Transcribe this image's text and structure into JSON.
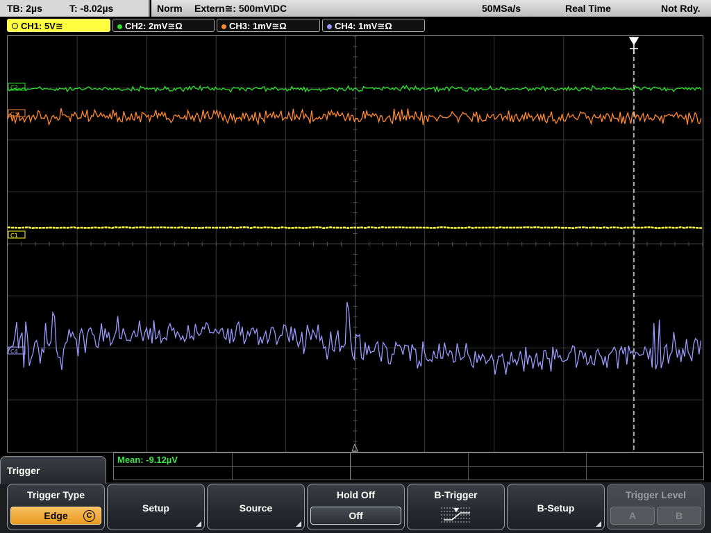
{
  "status": {
    "timebase": "TB: 2µs",
    "trigger_time": "T: -8.02µs",
    "mode": "Norm",
    "trigger_source": "Extern≅: 500mV\\DC",
    "sample_rate": "50MSa/s",
    "acq_mode": "Real Time",
    "trigger_state": "Not Rdy."
  },
  "channels": [
    {
      "label": "CH1: 5V≅",
      "color": "#ffff30",
      "marker": "C1"
    },
    {
      "label": "CH2: 2mV≅Ω",
      "color": "#2de12d",
      "marker": "C2"
    },
    {
      "label": "CH3: 1mV≅Ω",
      "color": "#ff8a30",
      "marker": "C3"
    },
    {
      "label": "CH4: 1mV≅Ω",
      "color": "#9a9aff",
      "marker": "C4"
    }
  ],
  "measurement": {
    "mean": "Mean: -9.12µV"
  },
  "menu": {
    "title": "Trigger",
    "keys": {
      "trigger_type": "Trigger Type",
      "trigger_type_value": "Edge",
      "trigger_type_coupling": "C",
      "setup": "Setup",
      "source": "Source",
      "hold_off": "Hold Off",
      "hold_off_value": "Off",
      "b_trigger": "B-Trigger",
      "b_setup": "B-Setup",
      "trigger_level": "Trigger Level",
      "level_a": "A",
      "level_b": "B"
    }
  },
  "colors": {
    "accent": "#f0a830",
    "grid": "#555555",
    "background": "#000000"
  }
}
